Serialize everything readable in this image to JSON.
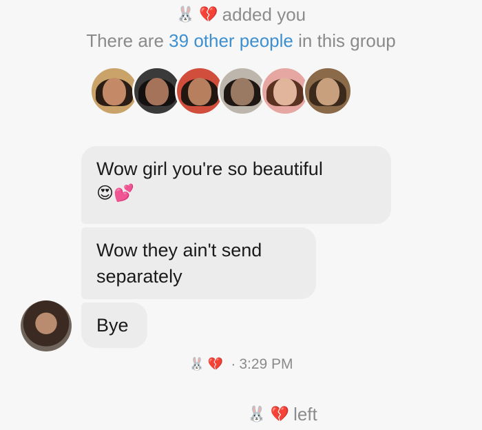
{
  "header": {
    "actor_emojis": [
      "🐰",
      "💔"
    ],
    "added_text": "added you",
    "group_prefix": "There are",
    "group_link": "39 other people",
    "group_suffix": "in this group"
  },
  "group_avatars": [
    {
      "name": "member-avatar-1",
      "bg": "#c9a36a",
      "face": "#c48a68",
      "hair": "#2a1d16"
    },
    {
      "name": "member-avatar-2",
      "bg": "#3a3a3a",
      "face": "#a5735a",
      "hair": "#151010"
    },
    {
      "name": "member-avatar-3",
      "bg": "#d24e3c",
      "face": "#b77f5e",
      "hair": "#221611"
    },
    {
      "name": "member-avatar-4",
      "bg": "#bdb6ad",
      "face": "#9a7a62",
      "hair": "#1e1714"
    },
    {
      "name": "member-avatar-5",
      "bg": "#e6a7a3",
      "face": "#e1b49c",
      "hair": "#5a3222"
    },
    {
      "name": "member-avatar-6",
      "bg": "#8b6a4a",
      "face": "#c8a07d",
      "hair": "#3b2a1c"
    }
  ],
  "messages": [
    {
      "text": "Wow girl you're so beautiful",
      "emojis": "😍💕"
    },
    {
      "text": "Wow they ain't send separately"
    },
    {
      "text": "Bye"
    }
  ],
  "seen": {
    "emojis": [
      "🐰",
      "💔"
    ],
    "separator": "·",
    "time": "3:29 PM"
  },
  "left_event": {
    "emojis": [
      "🐰",
      "💔"
    ],
    "text": "left"
  },
  "colors": {
    "background": "#f7f7f7",
    "bubble": "#ececec",
    "link": "#3d8fd0",
    "meta_text": "#8a8a8a"
  }
}
